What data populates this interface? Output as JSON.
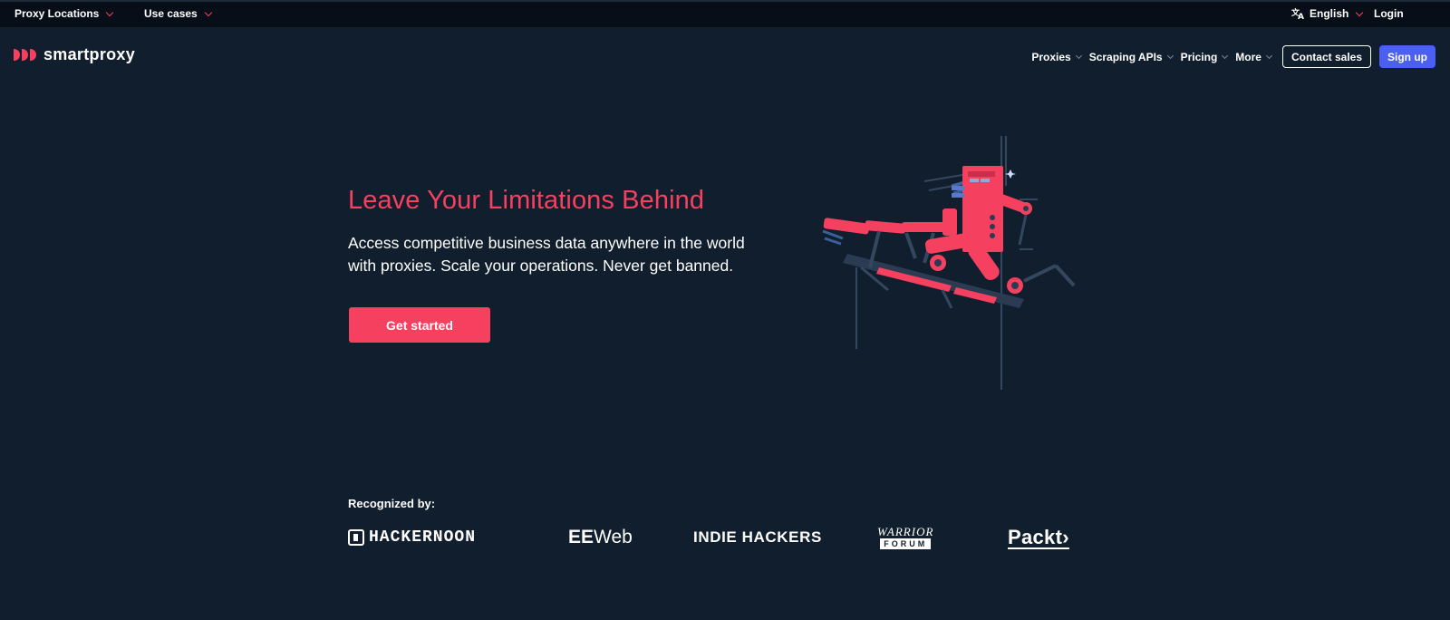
{
  "topbar": {
    "proxy_locations": "Proxy Locations",
    "use_cases": "Use cases",
    "language": "English",
    "login": "Login",
    "language_icon": "translate-icon"
  },
  "brand": {
    "name": "smartproxy",
    "accent": "#f6405f"
  },
  "nav": {
    "items": [
      {
        "label": "Proxies"
      },
      {
        "label": "Scraping APIs"
      },
      {
        "label": "Pricing"
      },
      {
        "label": "More"
      }
    ],
    "contact_sales": "Contact sales",
    "sign_up": "Sign up",
    "signup_color": "#4b5ff0"
  },
  "hero": {
    "title": "Leave Your Limitations Behind",
    "subtitle": "Access competitive business data anywhere in the world with proxies. Scale your operations. Never get banned.",
    "cta": "Get started"
  },
  "recognized": {
    "label": "Recognized by:",
    "brands": {
      "hackernoon": "HACKERNOON",
      "eeweb_bold": "EE",
      "eeweb_light": "Web",
      "indiehackers": "INDIE HACKERS",
      "warrior_top": "WARRIOR",
      "warrior_bottom": "FORUM",
      "packt": "Packt›"
    }
  },
  "colors": {
    "background": "#111e2d",
    "topbar": "#070e17"
  }
}
